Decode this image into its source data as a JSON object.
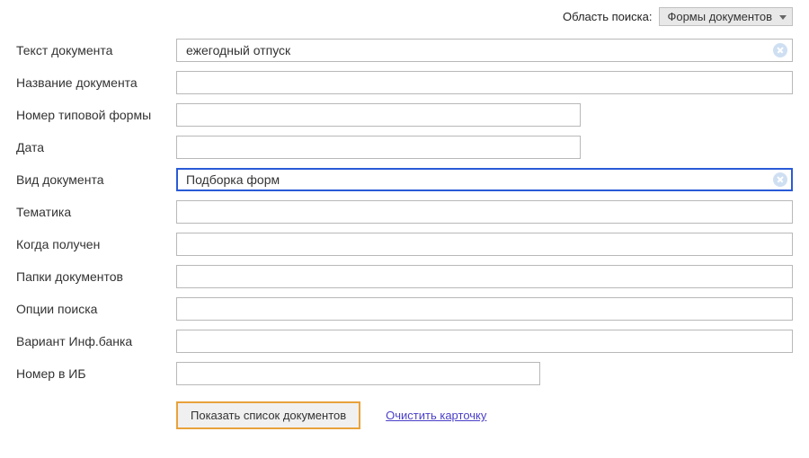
{
  "topbar": {
    "area_label": "Область поиска:",
    "area_selected": "Формы документов"
  },
  "fields": {
    "text": {
      "label": "Текст документа",
      "value": "ежегодный отпуск"
    },
    "title": {
      "label": "Название документа",
      "value": ""
    },
    "formnum": {
      "label": "Номер типовой формы",
      "value": ""
    },
    "date": {
      "label": "Дата",
      "value": ""
    },
    "kind": {
      "label": "Вид документа",
      "value": "Подборка форм"
    },
    "topic": {
      "label": "Тематика",
      "value": ""
    },
    "received": {
      "label": "Когда получен",
      "value": ""
    },
    "folders": {
      "label": "Папки документов",
      "value": ""
    },
    "options": {
      "label": "Опции поиска",
      "value": ""
    },
    "bankvar": {
      "label": "Вариант Инф.банка",
      "value": ""
    },
    "ibnum": {
      "label": "Номер в ИБ",
      "value": ""
    }
  },
  "actions": {
    "submit": "Показать список документов",
    "clear": "Очистить карточку"
  }
}
